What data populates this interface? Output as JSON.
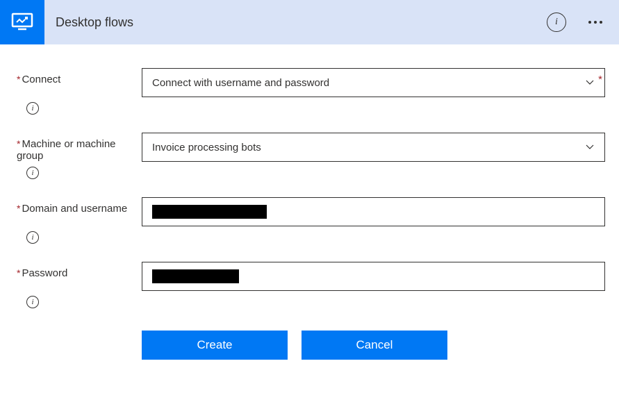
{
  "header": {
    "title": "Desktop flows",
    "icon": "desktop-flows-icon",
    "info_glyph": "i",
    "more_glyph": "..."
  },
  "form": {
    "connect": {
      "label": "Connect",
      "required": true,
      "value": "Connect with username and password"
    },
    "machine": {
      "label": "Machine or machine group",
      "required": true,
      "value": "Invoice processing bots"
    },
    "domain_user": {
      "label": "Domain and username",
      "required": true,
      "value": "████████████████"
    },
    "password": {
      "label": "Password",
      "required": true,
      "value": "████████████"
    },
    "info_glyph": "i"
  },
  "actions": {
    "create": "Create",
    "cancel": "Cancel"
  }
}
